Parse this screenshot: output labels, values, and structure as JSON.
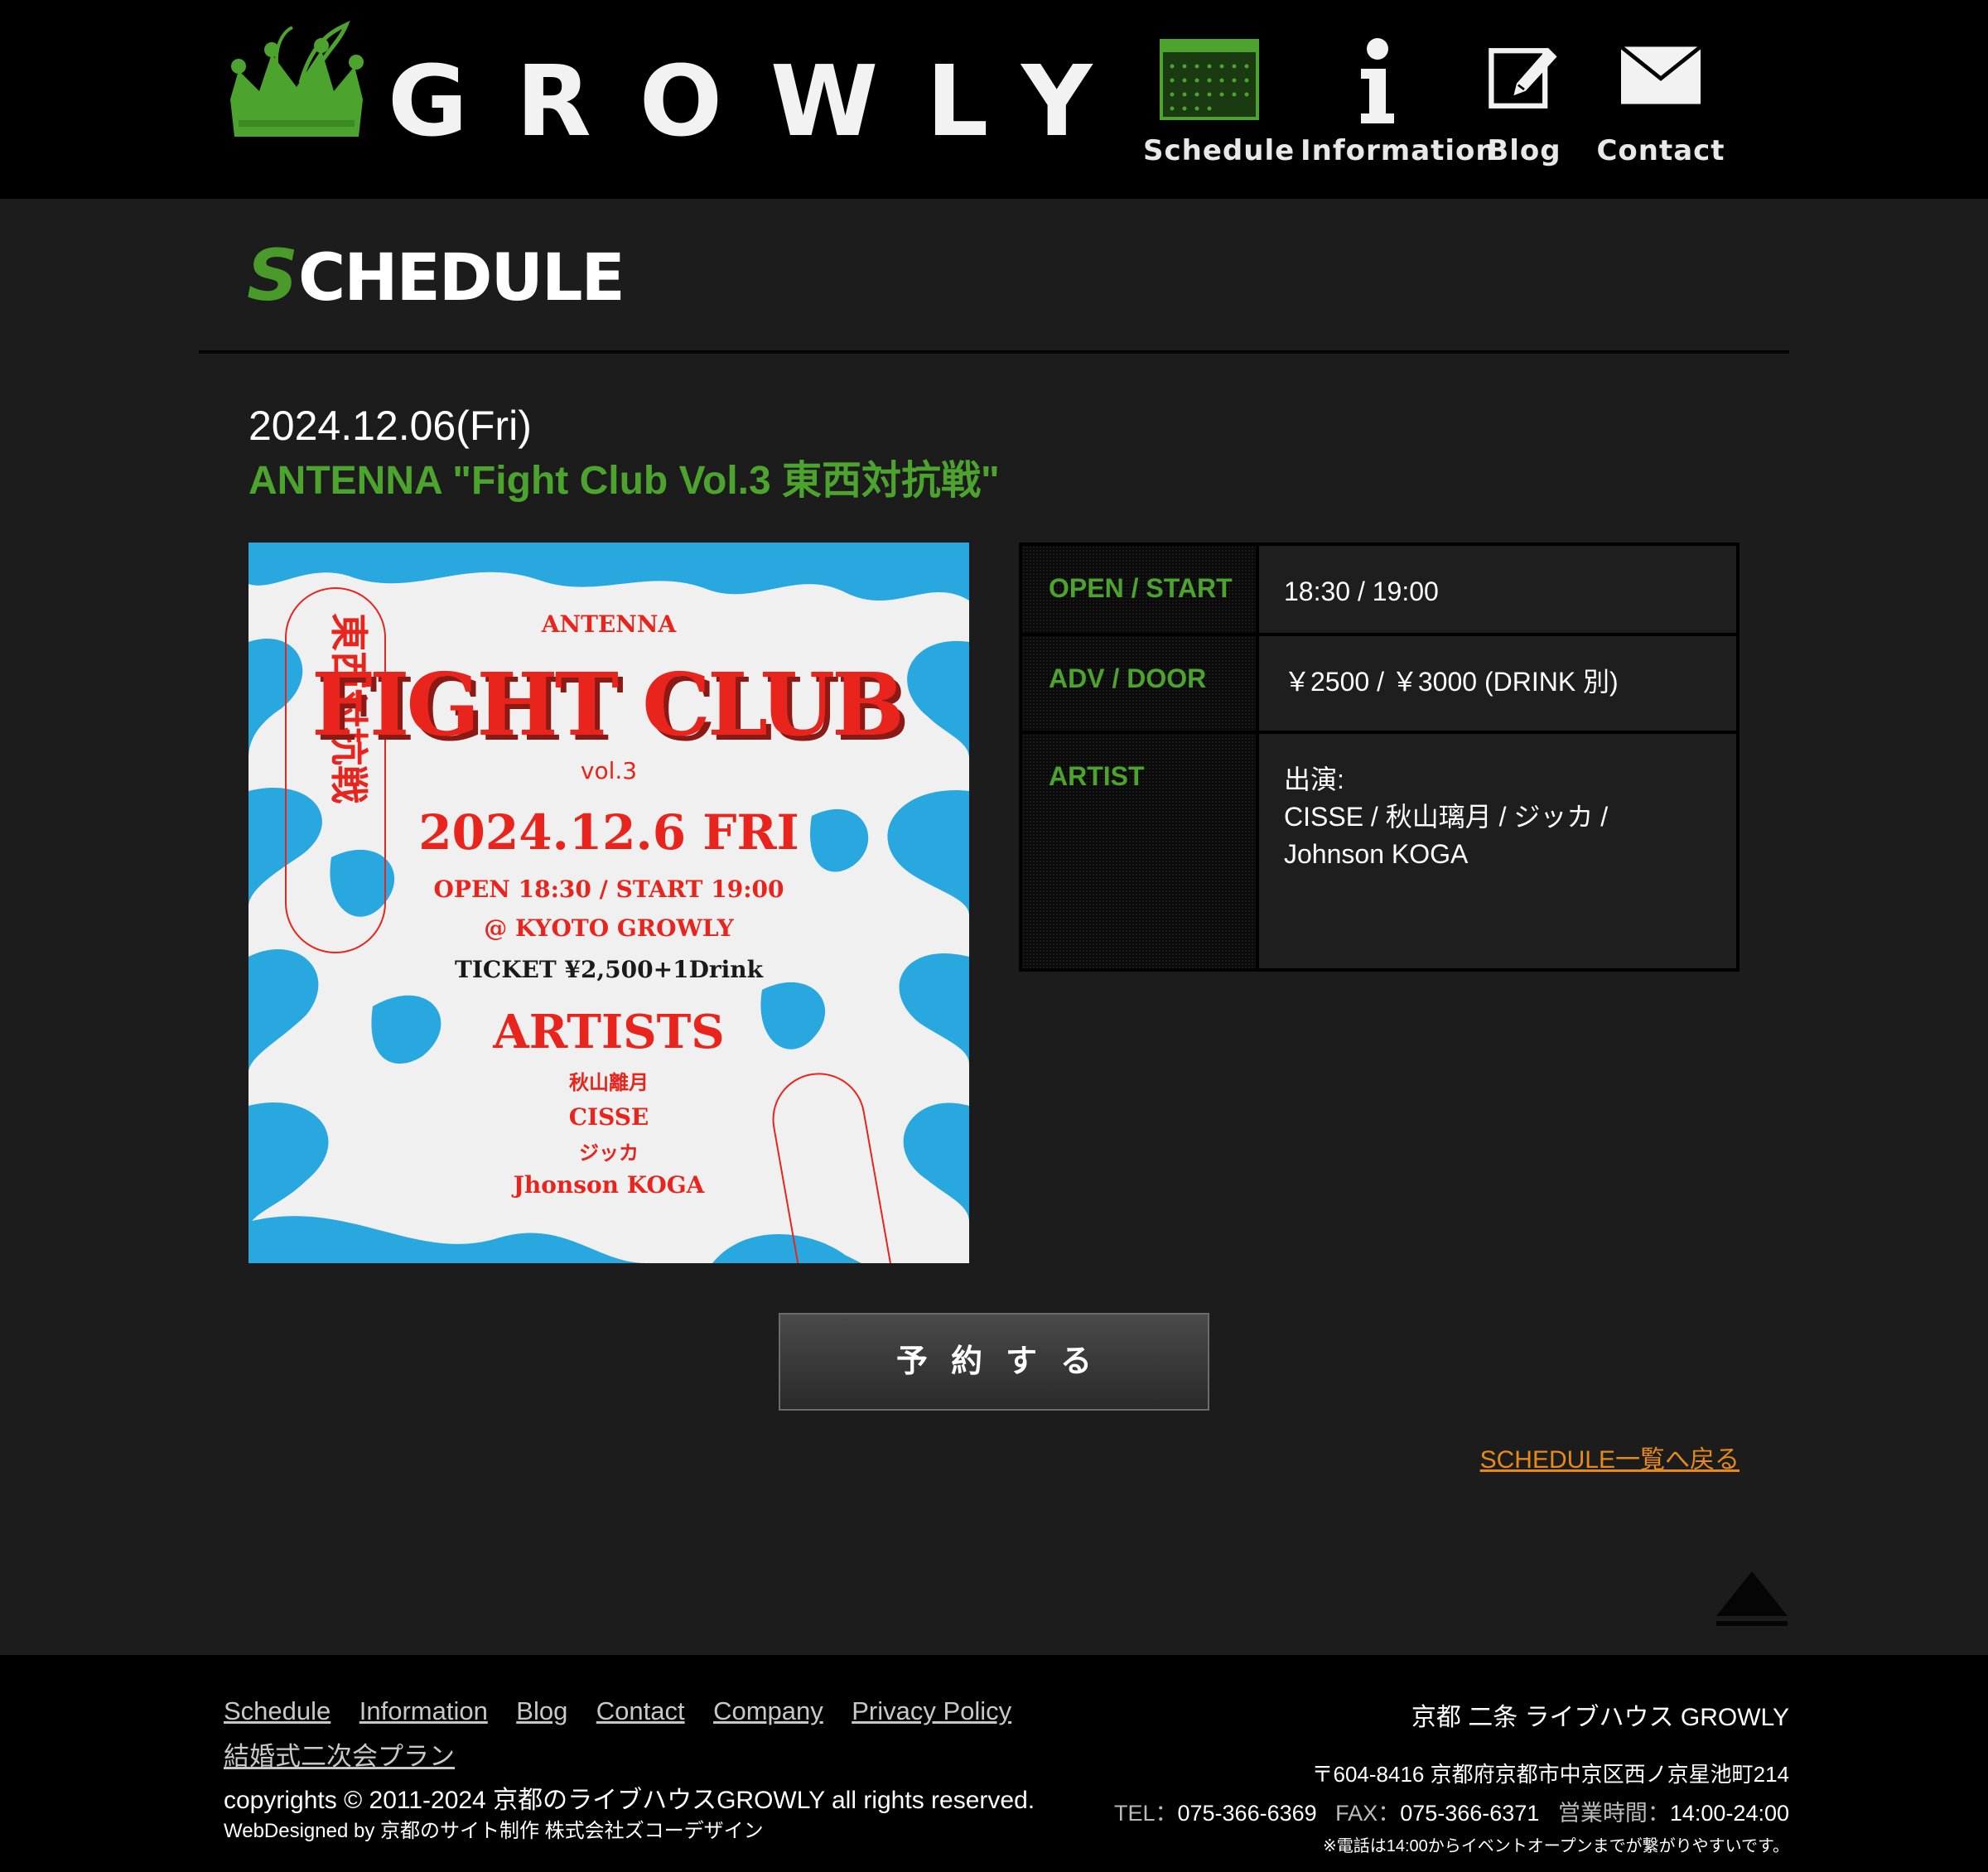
{
  "site": {
    "logo_text": "GROWLY",
    "brand_color": "#4ca32d"
  },
  "nav": {
    "items": [
      {
        "label": "Schedule",
        "icon": "calendar-icon"
      },
      {
        "label": "Information",
        "icon": "info-icon"
      },
      {
        "label": "Blog",
        "icon": "edit-icon"
      },
      {
        "label": "Contact",
        "icon": "mail-icon"
      }
    ]
  },
  "page": {
    "section_title_first": "S",
    "section_title_rest": "CHEDULE"
  },
  "event": {
    "date": "2024.12.06(Fri)",
    "title": "ANTENNA \"Fight Club Vol.3 東西対抗戦\"",
    "table": {
      "open_label": "OPEN / START",
      "open_value": "18:30 / 19:00",
      "price_label": "ADV / DOOR",
      "price_value": "￥2500 / ￥3000 (DRINK 別)",
      "artist_label": "ARTIST",
      "artist_value_line1": "出演:",
      "artist_value_line2": "CISSE / 秋山璃月 / ジッカ / Johnson KOGA"
    }
  },
  "flyer": {
    "top": "ANTENNA",
    "title": "FIGHT CLUB",
    "vol": "vol.3",
    "date": "2024.12.6 FRI",
    "times": "OPEN 18:30 / START 19:00",
    "venue": "@ KYOTO GROWLY",
    "ticket": "TICKET ¥2,500+1Drink",
    "artists_heading": "ARTISTS",
    "artists": [
      "秋山離月",
      "CISSE",
      "ジッカ",
      "Jhonson KOGA"
    ],
    "side_text": "東西対抗戦",
    "colors": {
      "background": "#f0f0f0",
      "swirl": "#29a8e0",
      "accent": "#e8241c"
    }
  },
  "actions": {
    "reserve_label": "予約する",
    "back_label": "SCHEDULE一覧へ戻る",
    "back_color": "#e68a1c"
  },
  "footer": {
    "links": [
      "Schedule",
      "Information",
      "Blog",
      "Contact",
      "Company",
      "Privacy Policy",
      "結婚式二次会プラン"
    ],
    "copyright": "copyrights © 2011-2024 京都のライブハウスGROWLY all rights reserved.",
    "webdesign": "WebDesigned by 京都のサイト制作 株式会社ズコーデザイン",
    "venue": "京都 二条 ライブハウス GROWLY",
    "address": "〒604-8416 京都府京都市中京区西ノ京星池町214",
    "tel_label": "TEL：",
    "tel": "075-366-6369",
    "fax_label": "FAX：",
    "fax": "075-366-6371",
    "hours_label": "営業時間：",
    "hours": "14:00-24:00",
    "note": "※電話は14:00からイベントオープンまでが繋がりやすいです。"
  }
}
